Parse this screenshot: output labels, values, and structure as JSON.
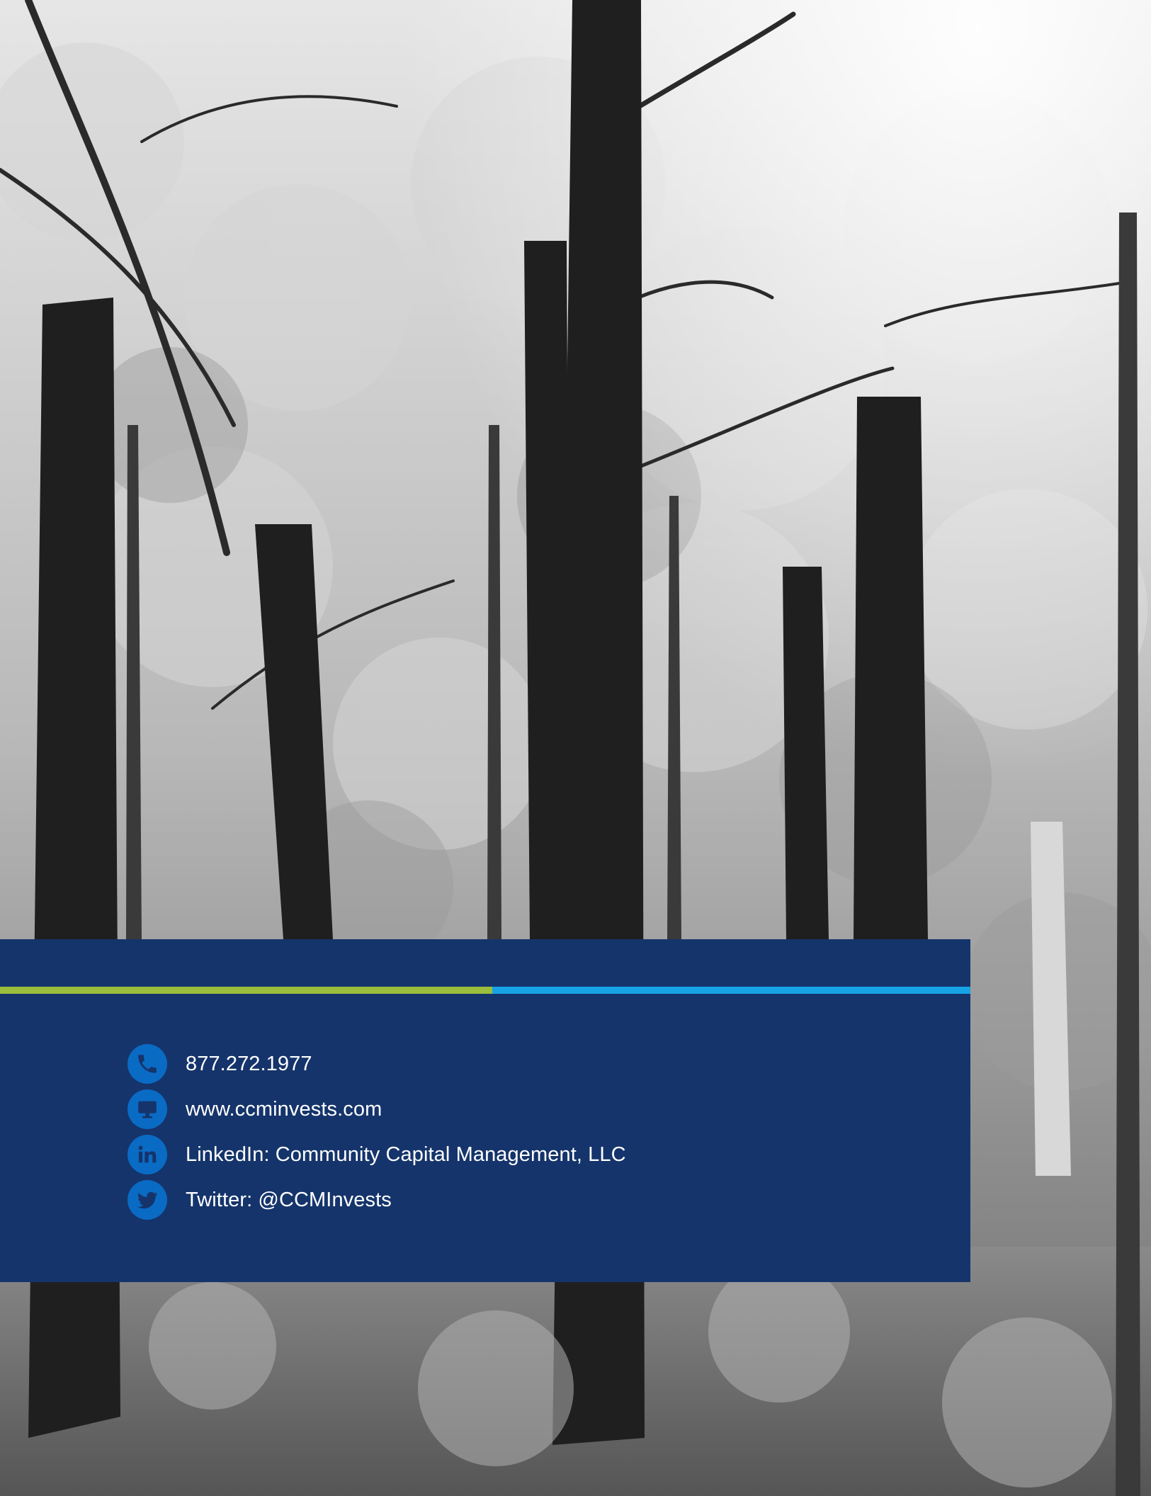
{
  "background": {
    "image_description_icon": "forest-photo-grayscale"
  },
  "colors": {
    "panel": "#15346b",
    "accent_green": "#9bbd3c",
    "accent_blue": "#16a4e6",
    "icon_circle": "#0a6bc4",
    "text": "#ffffff"
  },
  "contacts": [
    {
      "icon": "phone-icon",
      "text": "877.272.1977"
    },
    {
      "icon": "monitor-icon",
      "text": "www.ccminvests.com"
    },
    {
      "icon": "linkedin-icon",
      "text": "LinkedIn: Community Capital Management, LLC"
    },
    {
      "icon": "twitter-icon",
      "text": "Twitter: @CCMInvests"
    }
  ]
}
